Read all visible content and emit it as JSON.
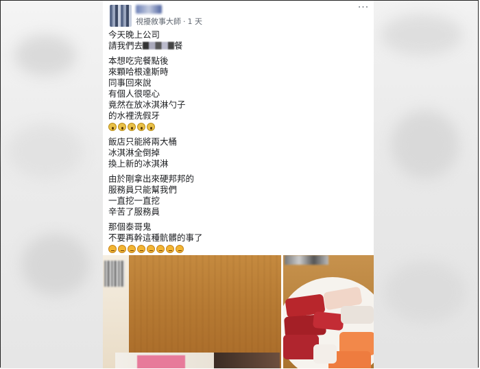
{
  "post": {
    "author_name": "",
    "group_name": "視擾敘事大師",
    "separator": "·",
    "timestamp": "1 天",
    "more_label": "···",
    "paragraphs": [
      {
        "lines": [
          {
            "text": "今天晚上公司"
          },
          {
            "before": "請我們去",
            "after": "餐"
          }
        ]
      },
      {
        "lines": [
          {
            "text": "本想吃完餐點後"
          },
          {
            "text": "來顆哈根達斯時"
          },
          {
            "text": "同事回來說"
          },
          {
            "text": "有個人很噁心"
          },
          {
            "text": "竟然在放冰淇淋勺子"
          },
          {
            "text": "的水裡洗假牙"
          }
        ],
        "emoji": {
          "name": "scream-face-icon",
          "kind": "scream",
          "count": 5
        }
      },
      {
        "lines": [
          {
            "text": "飯店只能將兩大桶"
          },
          {
            "text": "冰淇淋全倒掉"
          },
          {
            "text": "換上新的冰淇淋"
          }
        ]
      },
      {
        "lines": [
          {
            "text": "由於剛拿出來硬邦邦的"
          },
          {
            "text": "服務員只能幫我們"
          },
          {
            "text": "一直挖一直挖"
          },
          {
            "text": "辛苦了服務員"
          }
        ]
      },
      {
        "lines": [
          {
            "text": "那個泰哥鬼"
          },
          {
            "text": "不要再幹這種骯髒的事了"
          }
        ],
        "emoji": {
          "name": "angry-face-icon",
          "kind": "angry",
          "count": 8
        }
      }
    ]
  },
  "colors": {
    "text": "#1c1e21",
    "meta": "#606770",
    "background": "#ffffff"
  }
}
